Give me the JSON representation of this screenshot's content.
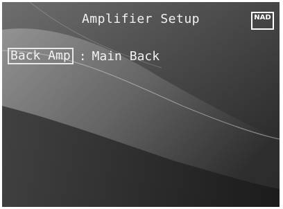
{
  "screen": {
    "title": "Amplifier Setup",
    "logo_text": "NAD"
  },
  "setting": {
    "label": "Back Amp",
    "separator": ":",
    "value": "Main Back"
  },
  "colors": {
    "text": "#f2f2f2",
    "background_dark": "#2a2a2a",
    "background_light": "#8a8a8a"
  }
}
